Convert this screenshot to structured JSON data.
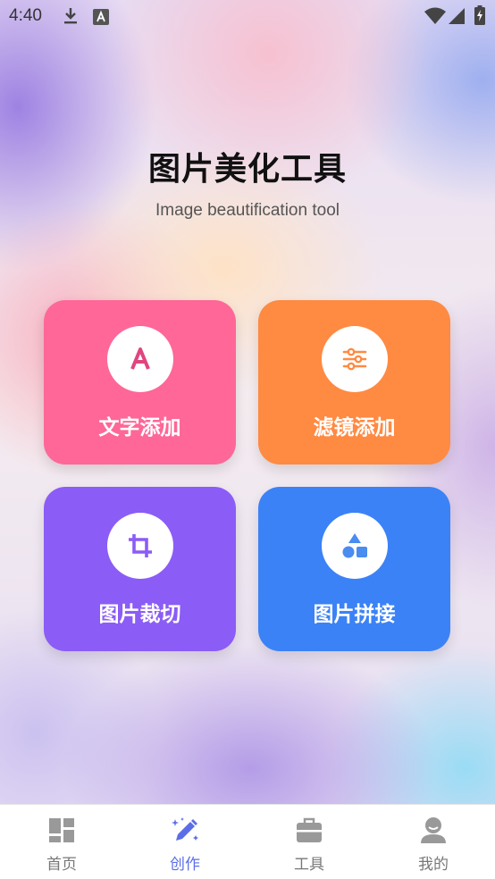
{
  "status_bar": {
    "time": "4:40",
    "icons": [
      "download-icon",
      "a-notification-icon",
      "wifi-icon",
      "signal-icon",
      "battery-charging-icon"
    ]
  },
  "header": {
    "title": "图片美化工具",
    "subtitle": "Image beautification tool"
  },
  "tools": [
    {
      "label": "文字添加",
      "icon": "text-a-icon",
      "color": "#fe6798"
    },
    {
      "label": "滤镜添加",
      "icon": "sliders-icon",
      "color": "#ff8a42"
    },
    {
      "label": "图片裁切",
      "icon": "crop-icon",
      "color": "#8b5cf6"
    },
    {
      "label": "图片拼接",
      "icon": "shapes-icon",
      "color": "#3b82f6"
    }
  ],
  "bottom_nav": {
    "active_index": 1,
    "active_color": "#5b6ee8",
    "items": [
      {
        "label": "首页",
        "icon": "dashboard-icon"
      },
      {
        "label": "创作",
        "icon": "magic-pen-icon"
      },
      {
        "label": "工具",
        "icon": "toolbox-icon"
      },
      {
        "label": "我的",
        "icon": "user-icon"
      }
    ]
  }
}
